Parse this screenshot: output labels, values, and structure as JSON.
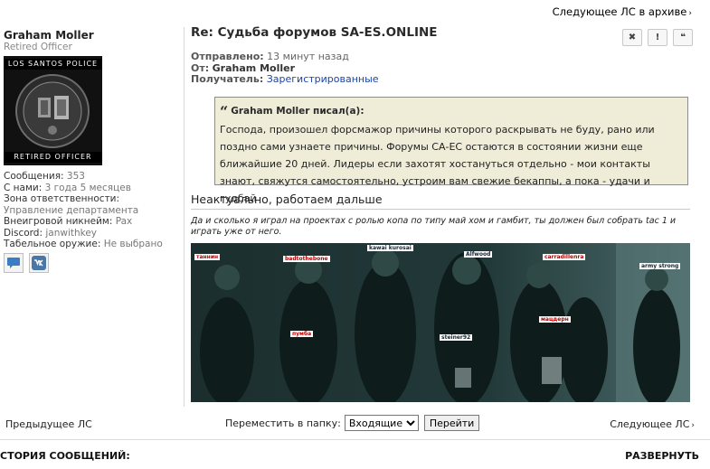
{
  "nav": {
    "next_archive": "Следующее ЛС в архиве",
    "prev_pm": "Предыдущее ЛС",
    "next_pm": "Следующее ЛС"
  },
  "user": {
    "name": "Graham Moller",
    "rank": "Retired Officer",
    "avatar_top": "LOS SANTOS POLICE",
    "avatar_bottom": "RETIRED OFFICER",
    "fields": [
      {
        "label": "Сообщения:",
        "value": "353"
      },
      {
        "label": "С нами:",
        "value": "3 года 5 месяцев"
      },
      {
        "label": "Зона ответственности:",
        "value": "Управление департамента"
      },
      {
        "label": "Внеигровой никнейм:",
        "value": "Pax"
      },
      {
        "label": "Discord:",
        "value": "janwithkey"
      },
      {
        "label": "Табельное оружие:",
        "value": "Не выбрано"
      }
    ]
  },
  "message": {
    "title": "Re: Судьба форумов SA-ES.ONLINE",
    "sent_label": "Отправлено:",
    "sent_value": "13 минут назад",
    "from_label": "От:",
    "from_value": "Graham Moller",
    "to_label": "Получатель:",
    "to_value": "Зарегистрированные",
    "quote_author": "Graham Moller писал(а):",
    "quote_text": "Господа, произошел форсмажор причины которого раскрывать не буду, рано или поздно сами узнаете причины. Форумы СА-ЕС остаются в состоянии жизни еще ближайшие 20 дней. Лидеры если захотят хостануться отдельно - мои контакты знают, свяжутся самостоятельно, устроим вам свежие бекаппы, а пока - удачи и гудбай",
    "reply": "Неактуально, работаем дальше",
    "signature": "Да и сколько я играл на проектах с ролью копа по типу май хом и гамбит, ты должен был собрать tac 1 и играть уже от него.",
    "image_tags": [
      "таннин",
      "badtothebone",
      "kawai kurosai",
      "Alfwood",
      "carradillenra",
      "army strong",
      "пумба",
      "steiner92",
      "мацдерн"
    ]
  },
  "actions": {
    "delete": "✖",
    "report": "!",
    "quote": "❝"
  },
  "move": {
    "label": "Переместить в папку:",
    "selected": "Входящие",
    "button": "Перейти"
  },
  "footer": {
    "history": "СТОРИЯ СООБЩЕНИЙ:",
    "expand": "РАЗВЕРНУТЬ"
  },
  "colors": {
    "link": "#1a44a8",
    "quote_bg": "#efecd8"
  }
}
